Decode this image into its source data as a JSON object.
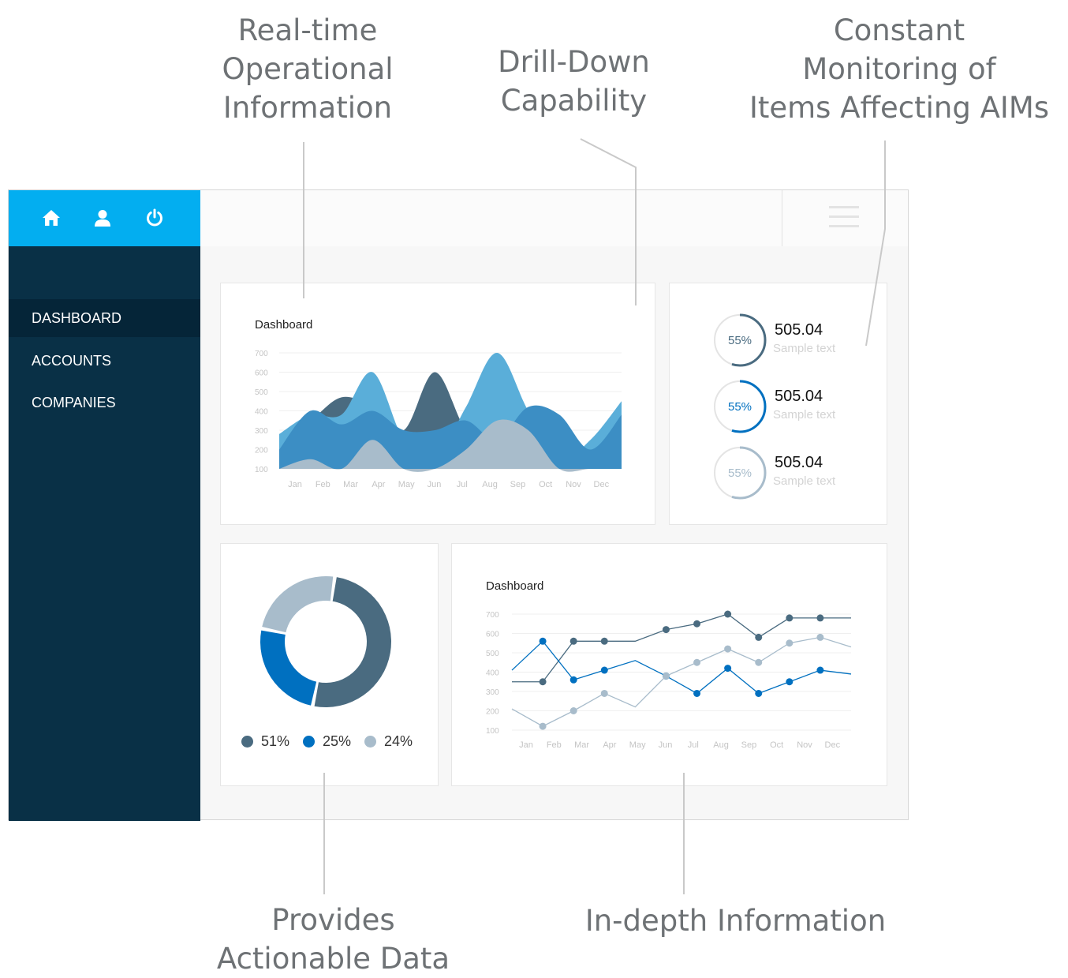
{
  "callouts": {
    "realtime": "Real-time\nOperational\nInformation",
    "drilldown": "Drill-Down\nCapability",
    "monitoring": "Constant\nMonitoring of\nItems Affecting AIMs",
    "actionable": "Provides\nActionable Data",
    "indepth": "In-depth Information"
  },
  "top_icons": [
    "home-icon",
    "user-icon",
    "power-icon"
  ],
  "sidebar": {
    "items": [
      {
        "label": "DASHBOARD",
        "active": true
      },
      {
        "label": "ACCOUNTS",
        "active": false
      },
      {
        "label": "COMPANIES",
        "active": false
      }
    ]
  },
  "colors": {
    "accent": "#03aef0",
    "sidebar": "#093046",
    "sidebar_active": "#052538",
    "series_dark": "#4a6b80",
    "series_blue": "#0070c0",
    "series_light": "#a8bccb",
    "area_mid": "#3c8ec4",
    "area_sky": "#5aaed9"
  },
  "area_card": {
    "title": "Dashboard",
    "chart_data": {
      "type": "area",
      "categories": [
        "Jan",
        "Feb",
        "Mar",
        "Apr",
        "May",
        "Jun",
        "Jul",
        "Aug",
        "Sep",
        "Oct",
        "Nov",
        "Dec"
      ],
      "y_ticks": [
        700,
        600,
        500,
        400,
        300,
        200,
        100
      ],
      "ylim": [
        100,
        700
      ],
      "grid": true,
      "series": [
        {
          "values": [
            250,
            350,
            470,
            420,
            300,
            600,
            300,
            200,
            400,
            350,
            200,
            400
          ]
        },
        {
          "values": [
            280,
            380,
            380,
            600,
            250,
            150,
            420,
            700,
            400,
            150,
            250,
            450
          ]
        },
        {
          "values": [
            200,
            400,
            330,
            400,
            300,
            300,
            350,
            250,
            420,
            380,
            200,
            380
          ]
        },
        {
          "values": [
            100,
            150,
            100,
            250,
            100,
            100,
            200,
            350,
            300,
            100,
            100,
            100
          ]
        }
      ]
    }
  },
  "stats": [
    {
      "percent": 55,
      "percent_label": "55%",
      "value": "505.04",
      "label": "Sample text",
      "color": "#4a6b80"
    },
    {
      "percent": 55,
      "percent_label": "55%",
      "value": "505.04",
      "label": "Sample text",
      "color": "#0070c0"
    },
    {
      "percent": 55,
      "percent_label": "55%",
      "value": "505.04",
      "label": "Sample text",
      "color": "#a8bccb"
    }
  ],
  "donut_card": {
    "chart_data": {
      "type": "pie",
      "slices": [
        {
          "value": 51,
          "label": "51%",
          "color": "#4a6b80"
        },
        {
          "value": 25,
          "label": "25%",
          "color": "#0070c0"
        },
        {
          "value": 24,
          "label": "24%",
          "color": "#a8bccb"
        }
      ]
    }
  },
  "line_card": {
    "title": "Dashboard",
    "chart_data": {
      "type": "line",
      "categories": [
        "Jan",
        "Feb",
        "Mar",
        "Apr",
        "May",
        "Jun",
        "Jul",
        "Aug",
        "Sep",
        "Oct",
        "Nov",
        "Dec"
      ],
      "y_ticks": [
        700,
        600,
        500,
        400,
        300,
        200,
        100
      ],
      "ylim": [
        100,
        700
      ],
      "grid": true,
      "series": [
        {
          "values": [
            350,
            350,
            560,
            560,
            560,
            620,
            650,
            700,
            580,
            680,
            680,
            680
          ],
          "markers": [
            1,
            2,
            3,
            5,
            6,
            7,
            8,
            9,
            10
          ]
        },
        {
          "values": [
            410,
            560,
            360,
            410,
            460,
            380,
            290,
            420,
            290,
            350,
            410,
            390
          ],
          "markers": [
            1,
            2,
            3,
            5,
            6,
            7,
            8,
            9,
            10
          ]
        },
        {
          "values": [
            210,
            120,
            200,
            290,
            220,
            380,
            450,
            520,
            450,
            550,
            580,
            530
          ],
          "markers": [
            1,
            2,
            3,
            5,
            6,
            7,
            8,
            9,
            10
          ]
        }
      ]
    }
  }
}
